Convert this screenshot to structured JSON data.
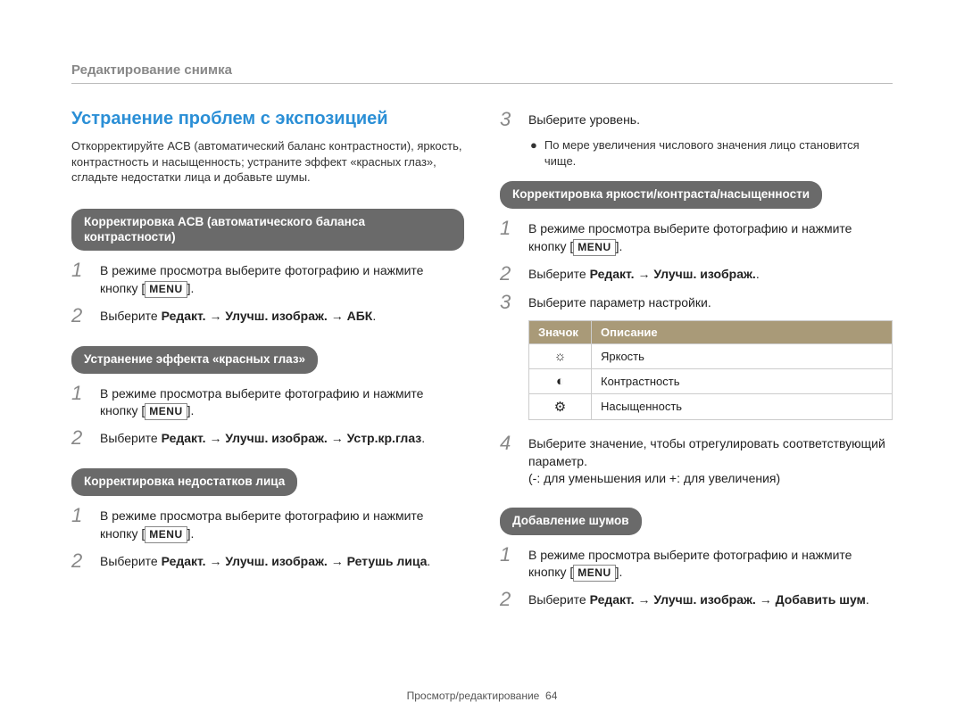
{
  "header": {
    "breadcrumb": "Редактирование снимка"
  },
  "left": {
    "title": "Устранение проблем с экспозицией",
    "intro": "Откорректируйте АСВ (автоматический баланс контрастности), яркость, контрастность и насыщенность; устраните эффект «красных глаз», сгладьте недостатки лица и добавьте шумы.",
    "sec1": {
      "pill": "Корректировка ACB (автоматического баланса контрастности)",
      "step1_a": "В режиме просмотра выберите фотографию и нажмите кнопку [",
      "step1_b": "MENU",
      "step1_c": "].",
      "step2_a": "Выберите ",
      "step2_b": "Редакт. → Улучш. изображ. → АБК",
      "step2_c": "."
    },
    "sec2": {
      "pill": "Устранение эффекта «красных глаз»",
      "step1_a": "В режиме просмотра выберите фотографию и нажмите кнопку [",
      "step1_b": "MENU",
      "step1_c": "].",
      "step2_a": "Выберите ",
      "step2_b": "Редакт. → Улучш. изображ. → Устр.кр.глаз",
      "step2_c": "."
    },
    "sec3": {
      "pill": "Корректировка недостатков лица",
      "step1_a": "В режиме просмотра выберите фотографию и нажмите кнопку [",
      "step1_b": "MENU",
      "step1_c": "].",
      "step2_a": "Выберите ",
      "step2_b": "Редакт. → Улучш. изображ. → Ретушь лица",
      "step2_c": "."
    }
  },
  "right": {
    "step3": "Выберите уровень.",
    "step3_sub": "По мере увеличения числового значения лицо становится чище.",
    "sec4": {
      "pill": "Корректировка яркости/контраста/насыщенности",
      "step1_a": "В режиме просмотра выберите фотографию и нажмите кнопку [",
      "step1_b": "MENU",
      "step1_c": "].",
      "step2_a": "Выберите ",
      "step2_b": "Редакт. → Улучш. изображ.",
      "step2_c": ".",
      "step3": "Выберите параметр настройки.",
      "table": {
        "h1": "Значок",
        "h2": "Описание",
        "rows": [
          {
            "icon": "☼",
            "desc": "Яркость"
          },
          {
            "icon": "◐",
            "desc": "Контрастность"
          },
          {
            "icon": "⚙",
            "desc": "Насыщенность"
          }
        ]
      },
      "step4_a": "Выберите значение, чтобы отрегулировать соответствующий параметр.",
      "step4_b": "(-: для уменьшения или +: для увеличения)"
    },
    "sec5": {
      "pill": "Добавление шумов",
      "step1_a": "В режиме просмотра выберите фотографию и нажмите кнопку [",
      "step1_b": "MENU",
      "step1_c": "].",
      "step2_a": "Выберите ",
      "step2_b": "Редакт. → Улучш. изображ. → Добавить шум",
      "step2_c": "."
    }
  },
  "footer": {
    "section": "Просмотр/редактирование",
    "page": "64"
  },
  "nums": {
    "n1": "1",
    "n2": "2",
    "n3": "3",
    "n4": "4"
  },
  "glyph": {
    "bullet": "●"
  }
}
